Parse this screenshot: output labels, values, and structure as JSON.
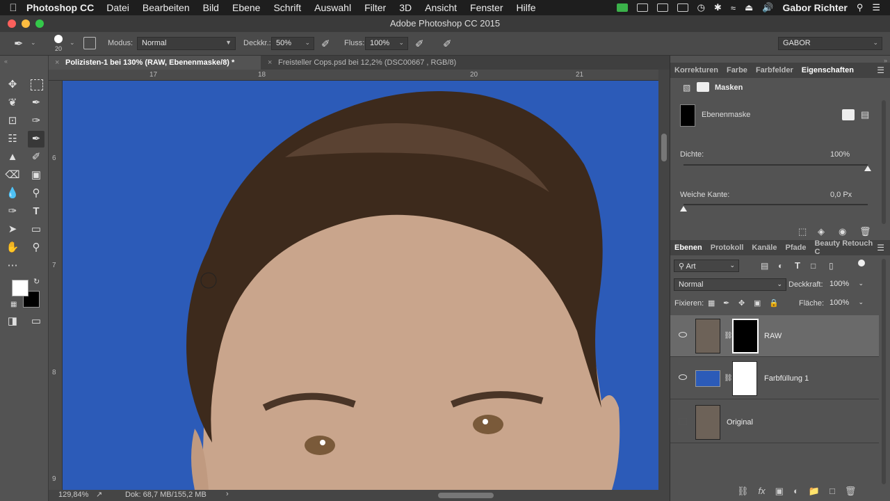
{
  "menubar": {
    "app_name": "Photoshop CC",
    "items": [
      "Datei",
      "Bearbeiten",
      "Bild",
      "Ebene",
      "Schrift",
      "Auswahl",
      "Filter",
      "3D",
      "Ansicht",
      "Fenster",
      "Hilfe"
    ],
    "user": "Gabor Richter"
  },
  "window": {
    "title": "Adobe Photoshop CC 2015"
  },
  "options": {
    "brush_size": "20",
    "mode_label": "Modus:",
    "mode_value": "Normal",
    "opacity_label": "Deckkr.:",
    "opacity_value": "50%",
    "flow_label": "Fluss:",
    "flow_value": "100%",
    "workspace": "GABOR"
  },
  "tabs": [
    {
      "label": "Polizisten-1 bei 130% (RAW, Ebenenmaske/8) *",
      "active": true
    },
    {
      "label": "Freisteller Cops.psd bei 12,2% (DSC00667 , RGB/8)",
      "active": false
    }
  ],
  "rulers": {
    "h": [
      "17",
      "18",
      "20",
      "21"
    ],
    "v": [
      "6",
      "7",
      "8",
      "9"
    ]
  },
  "status": {
    "zoom": "129,84%",
    "doc": "Dok: 68,7 MB/155,2 MB"
  },
  "props_panel": {
    "tabs": [
      "Korrekturen",
      "Farbe",
      "Farbfelder",
      "Eigenschaften"
    ],
    "header": "Masken",
    "mask_label": "Ebenenmaske",
    "density_label": "Dichte:",
    "density_value": "100%",
    "feather_label": "Weiche Kante:",
    "feather_value": "0,0 Px",
    "density_level": 1.0,
    "feather_level": 0.0
  },
  "layers_panel": {
    "tabs": [
      "Ebenen",
      "Protokoll",
      "Kanäle",
      "Pfade",
      "Beauty Retouch C"
    ],
    "filter": "Art",
    "blend_mode": "Normal",
    "opacity_label": "Deckkraft:",
    "opacity_value": "100%",
    "lock_label": "Fixieren:",
    "fill_label": "Fläche:",
    "fill_value": "100%",
    "layers": [
      {
        "name": "RAW",
        "visible": true,
        "selected": true
      },
      {
        "name": "Farbfüllung 1",
        "visible": true,
        "selected": false
      },
      {
        "name": "Original",
        "visible": false,
        "selected": false
      }
    ]
  },
  "colors": {
    "canvas_bg": "#2c5bb8",
    "ui_bg": "#535353",
    "hair": "#3d2a1c",
    "skin": "#c9a58c"
  }
}
